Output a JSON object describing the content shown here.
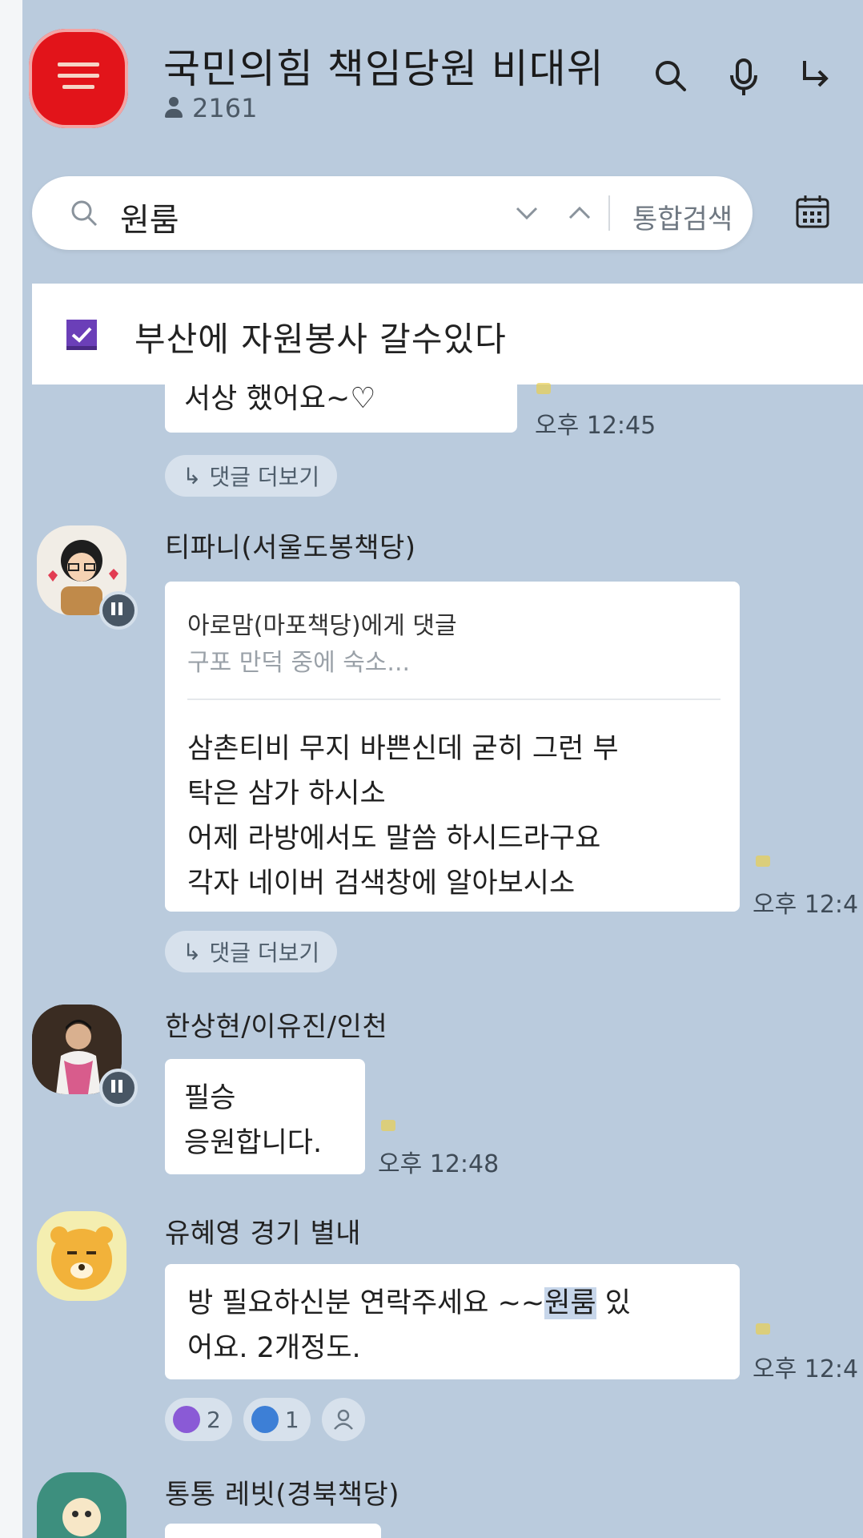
{
  "header": {
    "title": "국민의힘 책임당원 비대위",
    "member_count": "2161"
  },
  "search": {
    "query": "원룸",
    "integrated_label": "통합검색"
  },
  "notice": {
    "text": "부산에 자원봉사 갈수있다"
  },
  "messages": [
    {
      "partial_text": "서상 했어요~♡",
      "time": "오후 12:45",
      "reply_more": "댓글 더보기"
    },
    {
      "sender": "티파니(서울도봉책당)",
      "reply_to": "아로맘(마포책당)에게 댓글",
      "quoted": "구포 만덕 중에 숙소...",
      "lines": [
        "삼촌티비 무지 바쁜신데 굳히 그런 부",
        "탁은 삼가 하시소",
        "어제 라방에서도 말씀 하시드라구요",
        "각자 네이버 검색창에 알아보시소"
      ],
      "time": "오후 12:4",
      "reply_more": "댓글 더보기"
    },
    {
      "sender": "한상현/이유진/인천",
      "lines": [
        "필승",
        "응원합니다."
      ],
      "time": "오후 12:48"
    },
    {
      "sender": "유혜영 경기 별내",
      "line1_before": "방 필요하신분 연락주세요 ~~",
      "line1_highlight": "원룸",
      "line1_after": " 있",
      "line2": "어요. 2개정도.",
      "time": "오후 12:4",
      "reactions": {
        "like": "2",
        "check": "1"
      }
    },
    {
      "sender": "통통 레빗(경북책당)"
    }
  ],
  "colors": {
    "chat_background": "#bacbdd",
    "room_icon": "#e2141a",
    "notice_icon": "#6b3fb8"
  }
}
